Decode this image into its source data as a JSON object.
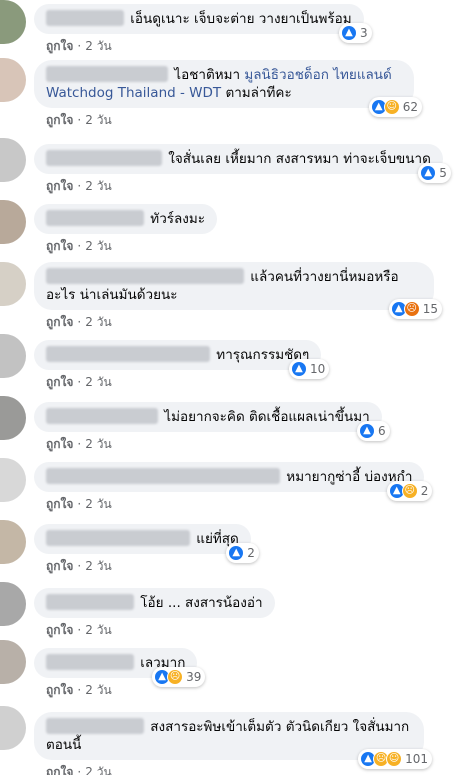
{
  "ui": {
    "like_label": "ถูกใจ",
    "time_label": "2 วัน"
  },
  "comments": [
    {
      "text": "เอ็นดูเนาะ เจ็บจะต่าย วางยาเป็นพร้อม",
      "reactions": [
        "like"
      ],
      "count": "3"
    },
    {
      "text_pre": "ไอชาติหมา",
      "link": "มูลนิธิวอชด็อก ไทยแลนด์ Watchdog Thailand - WDT",
      "text_post": "ตามล่าทีคะ",
      "reactions": [
        "like",
        "haha"
      ],
      "count": "62"
    },
    {
      "text": "ใจสั่นเลย เหี้ยมาก สงสารหมา ท่าจะเจ็บขนาด",
      "reactions": [
        "like"
      ],
      "count": "5"
    },
    {
      "text": "ทัวร์ลงมะ",
      "reactions": [],
      "count": ""
    },
    {
      "text": "แล้วคนที่วางยานี่หมอหรืออะไร น่าเล่นมันด้วยนะ",
      "reactions": [
        "like",
        "angry"
      ],
      "count": "15"
    },
    {
      "text": "ทารุณกรรมชัดๆ",
      "reactions": [
        "like"
      ],
      "count": "10"
    },
    {
      "text": "ไม่อยากจะคิด ติดเชื้อแผลเน่าขึ้นมา",
      "reactions": [
        "like"
      ],
      "count": "6"
    },
    {
      "text": "หมายากูซ่าอี้ บ่องหุกำ",
      "reactions": [
        "like",
        "sad"
      ],
      "count": "2"
    },
    {
      "text": "แย่ที่สุด",
      "reactions": [
        "like"
      ],
      "count": "2"
    },
    {
      "text": "โอ้ย ... สงสารน้องอ่า",
      "reactions": [],
      "count": ""
    },
    {
      "text": "เลวมาก",
      "reactions": [
        "like",
        "sad"
      ],
      "count": "39"
    },
    {
      "text": "สงสารอะพิษเข้าเต็มตัว ตัวนิดเกียว ใจสั่นมากตอนนี้",
      "reactions": [
        "like",
        "sad",
        "haha"
      ],
      "count": "101"
    }
  ],
  "reaction_icons": {
    "like": "thumbs-up-icon",
    "haha": "haha-icon",
    "angry": "angry-icon",
    "sad": "sad-icon"
  },
  "colors": {
    "like": "#1877f2",
    "haha": "#f7b125",
    "angry": "#e9710f",
    "link": "#385898"
  }
}
